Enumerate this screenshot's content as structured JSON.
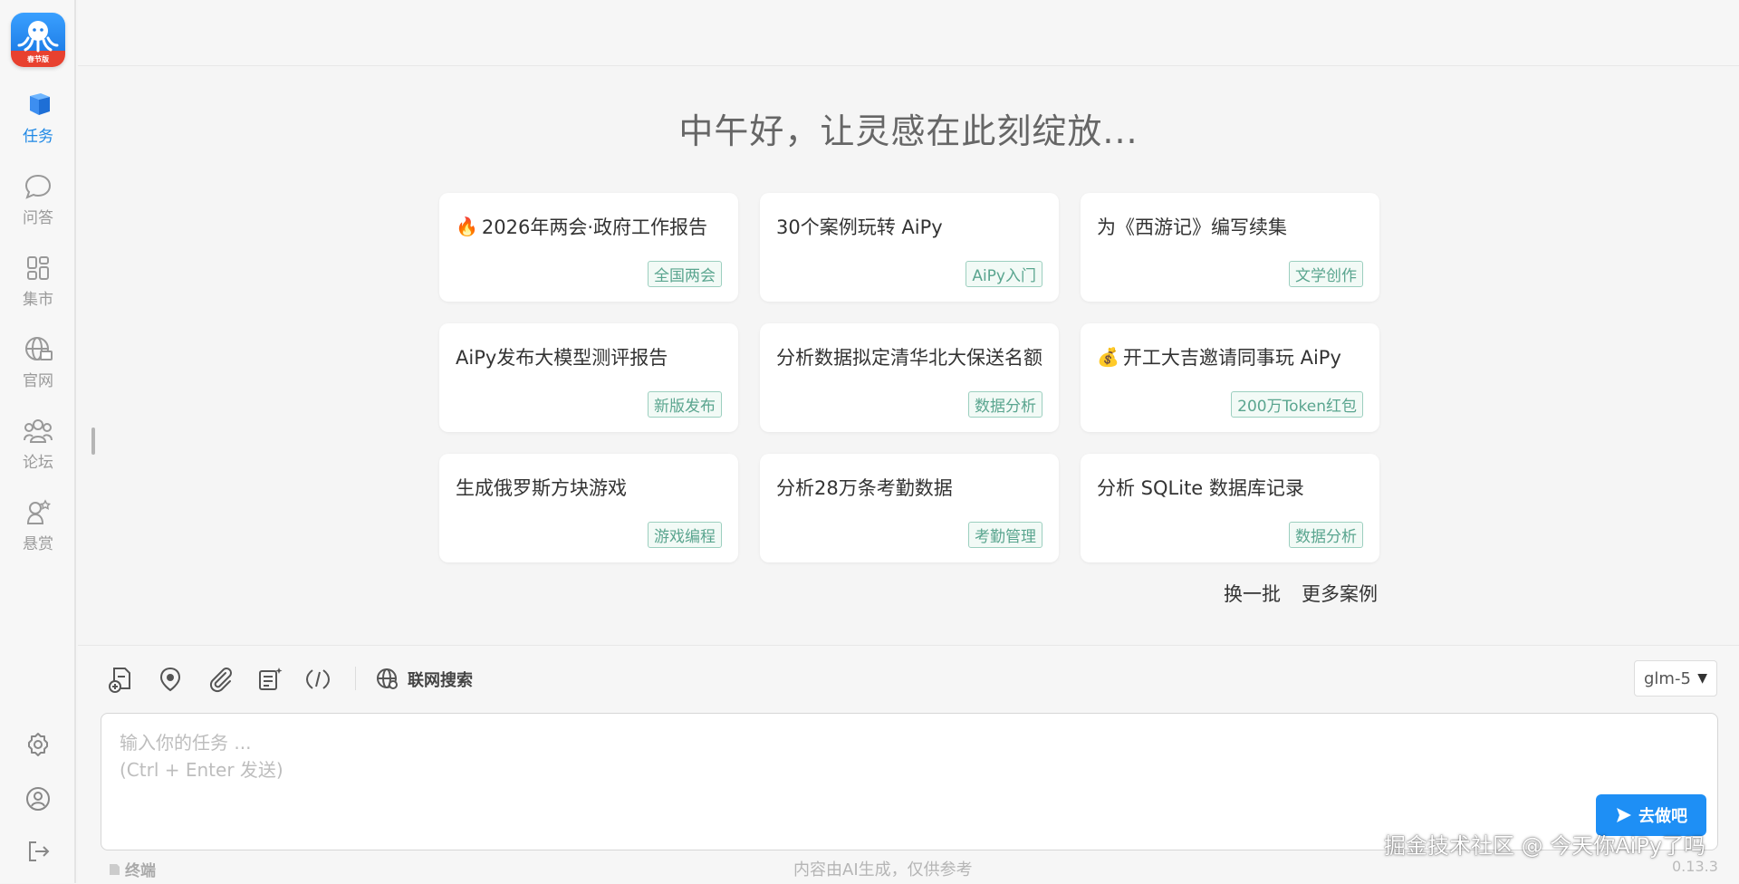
{
  "app": {
    "logo_label": "春节版"
  },
  "sidebar": {
    "items": [
      {
        "label": "任务",
        "icon": "cube-icon",
        "active": true
      },
      {
        "label": "问答",
        "icon": "chat-icon",
        "active": false
      },
      {
        "label": "集市",
        "icon": "apps-grid-icon",
        "active": false
      },
      {
        "label": "官网",
        "icon": "globe-icon",
        "active": false
      },
      {
        "label": "论坛",
        "icon": "community-icon",
        "active": false
      },
      {
        "label": "悬赏",
        "icon": "reward-icon",
        "active": false
      }
    ],
    "bottom_icons": [
      "settings-icon",
      "user-icon",
      "logout-icon"
    ]
  },
  "main": {
    "greeting": "中午好，让灵感在此刻绽放...",
    "cards": [
      {
        "emoji": "🔥",
        "title": "2026年两会·政府工作报告",
        "tag": "全国两会"
      },
      {
        "emoji": "",
        "title": "30个案例玩转 AiPy",
        "tag": "AiPy入门"
      },
      {
        "emoji": "",
        "title": "为《西游记》编写续集",
        "tag": "文学创作"
      },
      {
        "emoji": "",
        "title": "AiPy发布大模型测评报告",
        "tag": "新版发布"
      },
      {
        "emoji": "",
        "title": "分析数据拟定清华北大保送名额",
        "tag": "数据分析"
      },
      {
        "emoji": "💰",
        "title": "开工大吉邀请同事玩 AiPy",
        "tag": "200万Token红包"
      },
      {
        "emoji": "",
        "title": "生成俄罗斯方块游戏",
        "tag": "游戏编程"
      },
      {
        "emoji": "",
        "title": "分析28万条考勤数据",
        "tag": "考勤管理"
      },
      {
        "emoji": "",
        "title": "分析 SQLite 数据库记录",
        "tag": "数据分析"
      }
    ],
    "refresh_label": "换一批",
    "more_label": "更多案例"
  },
  "composer": {
    "web_search_label": "联网搜索",
    "model": "glm-5",
    "placeholder_line1": "输入你的任务 ...",
    "placeholder_line2": "(Ctrl + Enter 发送)",
    "send_label": "去做吧",
    "terminal_label": "终端",
    "footer_note": "内容由AI生成，仅供参考",
    "version": "0.13.3"
  },
  "watermark": "掘金技术社区 @ 今天你AiPy了吗",
  "colors": {
    "accent": "#1e8ff5",
    "tag_green": "#5aa58f",
    "active_nav": "#1e88e5"
  }
}
